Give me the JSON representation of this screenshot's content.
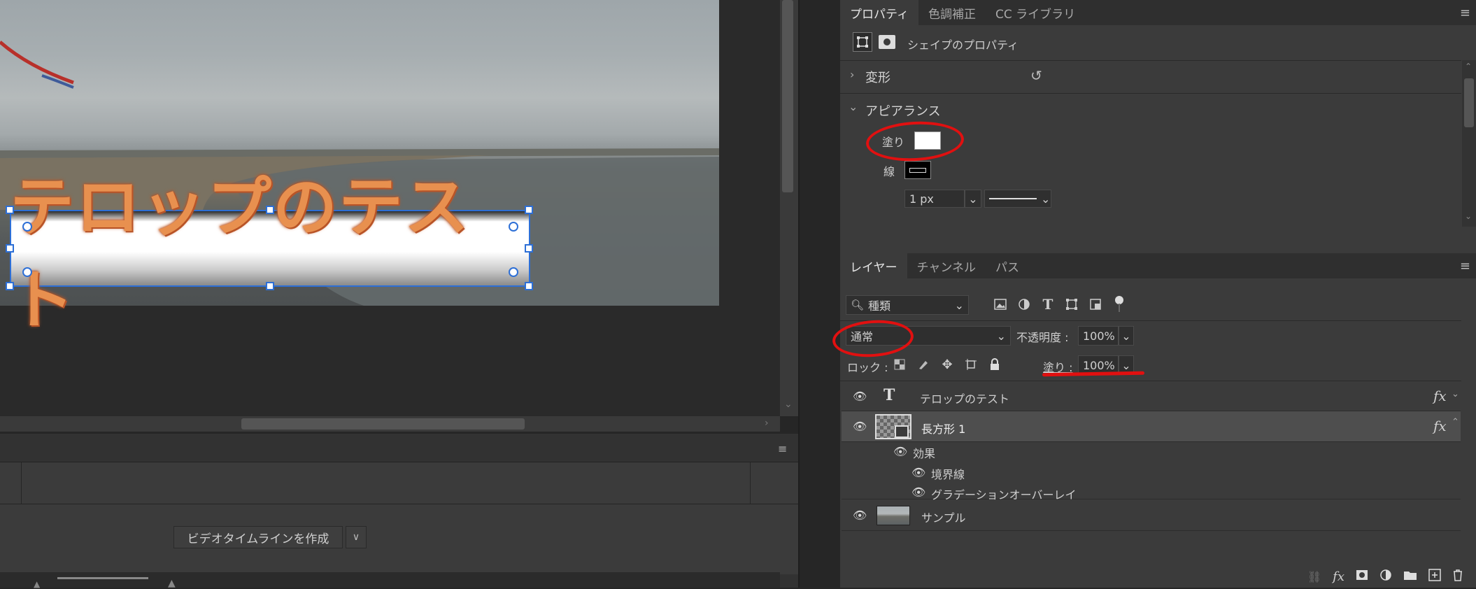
{
  "canvas": {
    "telop_text": "テロップのテスト"
  },
  "timeline": {
    "create_button_label": "ビデオタイムラインを作成"
  },
  "properties_panel": {
    "tabs": [
      {
        "label": "プロパティ",
        "active": true
      },
      {
        "label": "色調補正",
        "active": false
      },
      {
        "label": "CC ライブラリ",
        "active": false
      }
    ],
    "section_title": "シェイプのプロパティ",
    "transform_label": "変形",
    "appearance_label": "アピアランス",
    "fill_label": "塗り",
    "stroke_label": "線",
    "stroke_width": "1 px",
    "fill_color": "#ffffff",
    "stroke_color": "#000000"
  },
  "layers_panel": {
    "tabs": [
      {
        "label": "レイヤー",
        "active": true
      },
      {
        "label": "チャンネル",
        "active": false
      },
      {
        "label": "パス",
        "active": false
      }
    ],
    "filter_kind": "種類",
    "blend_mode": "通常",
    "opacity_label": "不透明度 :",
    "opacity_value": "100%",
    "lock_label": "ロック :",
    "fill_label": "塗り :",
    "fill_value": "100%",
    "layers": [
      {
        "name": "テロップのテスト",
        "type": "text"
      },
      {
        "name": "長方形 1",
        "type": "shape",
        "selected": true
      },
      {
        "name": "効果",
        "type": "effects"
      },
      {
        "name": "境界線",
        "type": "effect"
      },
      {
        "name": "グラデーションオーバーレイ",
        "type": "effect"
      },
      {
        "name": "サンプル",
        "type": "image"
      }
    ]
  },
  "colors": {
    "annotation_red": "#e11010",
    "selection_blue": "#2d6fd6"
  }
}
